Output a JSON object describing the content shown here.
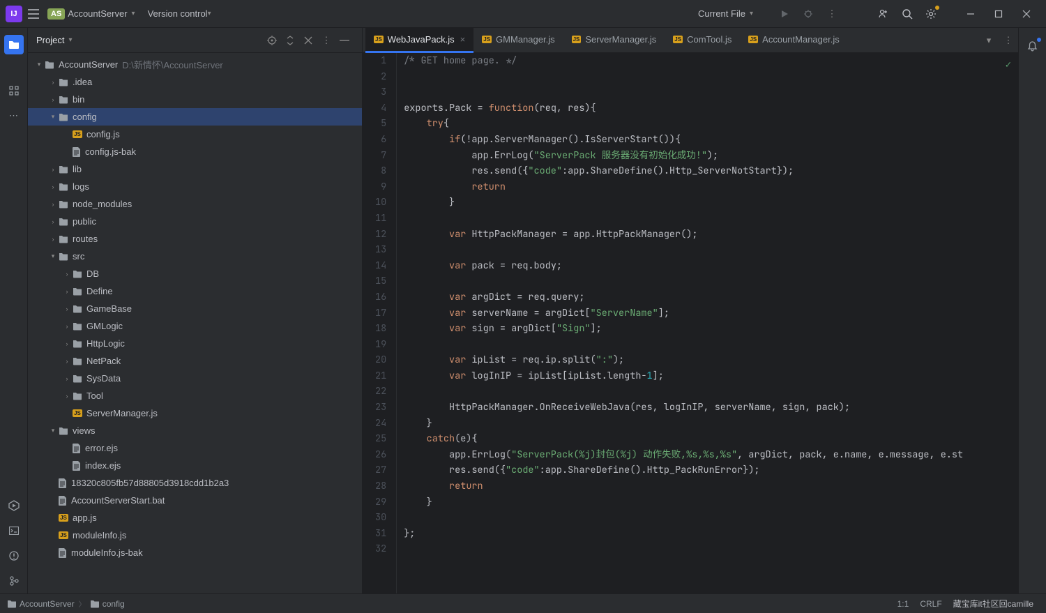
{
  "titlebar": {
    "logo": "IJ",
    "project_badge": "AS",
    "project_name": "AccountServer",
    "version_control": "Version control",
    "current_file": "Current File"
  },
  "project_panel": {
    "title": "Project"
  },
  "tree": {
    "root": "AccountServer",
    "root_hint": "D:\\新情怀\\AccountServer",
    "items": [
      {
        "t": "f",
        "l": ".idea",
        "d": 1,
        "a": ">"
      },
      {
        "t": "f",
        "l": "bin",
        "d": 1,
        "a": ">"
      },
      {
        "t": "f",
        "l": "config",
        "d": 1,
        "a": "v",
        "sel": true
      },
      {
        "t": "js",
        "l": "config.js",
        "d": 2
      },
      {
        "t": "file",
        "l": "config.js-bak",
        "d": 2
      },
      {
        "t": "f",
        "l": "lib",
        "d": 1,
        "a": ">"
      },
      {
        "t": "f",
        "l": "logs",
        "d": 1,
        "a": ">"
      },
      {
        "t": "f",
        "l": "node_modules",
        "d": 1,
        "a": ">"
      },
      {
        "t": "f",
        "l": "public",
        "d": 1,
        "a": ">"
      },
      {
        "t": "f",
        "l": "routes",
        "d": 1,
        "a": ">"
      },
      {
        "t": "f",
        "l": "src",
        "d": 1,
        "a": "v"
      },
      {
        "t": "f",
        "l": "DB",
        "d": 2,
        "a": ">"
      },
      {
        "t": "f",
        "l": "Define",
        "d": 2,
        "a": ">"
      },
      {
        "t": "f",
        "l": "GameBase",
        "d": 2,
        "a": ">"
      },
      {
        "t": "f",
        "l": "GMLogic",
        "d": 2,
        "a": ">"
      },
      {
        "t": "f",
        "l": "HttpLogic",
        "d": 2,
        "a": ">"
      },
      {
        "t": "f",
        "l": "NetPack",
        "d": 2,
        "a": ">"
      },
      {
        "t": "f",
        "l": "SysData",
        "d": 2,
        "a": ">"
      },
      {
        "t": "f",
        "l": "Tool",
        "d": 2,
        "a": ">"
      },
      {
        "t": "js",
        "l": "ServerManager.js",
        "d": 2
      },
      {
        "t": "f",
        "l": "views",
        "d": 1,
        "a": "v"
      },
      {
        "t": "file",
        "l": "error.ejs",
        "d": 2
      },
      {
        "t": "file",
        "l": "index.ejs",
        "d": 2
      },
      {
        "t": "file",
        "l": "18320c805fb57d88805d3918cdd1b2a3",
        "d": 1
      },
      {
        "t": "file",
        "l": "AccountServerStart.bat",
        "d": 1
      },
      {
        "t": "js",
        "l": "app.js",
        "d": 1
      },
      {
        "t": "js",
        "l": "moduleInfo.js",
        "d": 1
      },
      {
        "t": "file",
        "l": "moduleInfo.js-bak",
        "d": 1
      }
    ]
  },
  "tabs": [
    {
      "l": "WebJavaPack.js",
      "active": true
    },
    {
      "l": "GMManager.js"
    },
    {
      "l": "ServerManager.js"
    },
    {
      "l": "ComTool.js"
    },
    {
      "l": "AccountManager.js"
    }
  ],
  "code_lines": [
    [
      [
        "cmt",
        "/* GET home page. */"
      ]
    ],
    [],
    [],
    [
      [
        "p",
        "exports.Pack = "
      ],
      [
        "kw",
        "function"
      ],
      [
        "p",
        "(req, res){"
      ]
    ],
    [
      [
        "p",
        "    "
      ],
      [
        "kw",
        "try"
      ],
      [
        "p",
        "{"
      ]
    ],
    [
      [
        "p",
        "        "
      ],
      [
        "kw",
        "if"
      ],
      [
        "p",
        "(!app.ServerManager().IsServerStart()){"
      ]
    ],
    [
      [
        "p",
        "            app.ErrLog("
      ],
      [
        "str",
        "\"ServerPack 服务器没有初始化成功!\""
      ],
      [
        "p",
        ");"
      ]
    ],
    [
      [
        "p",
        "            res.send({"
      ],
      [
        "str",
        "\"code\""
      ],
      [
        "p",
        ":app.ShareDefine().Http_ServerNotStart});"
      ]
    ],
    [
      [
        "p",
        "            "
      ],
      [
        "kw",
        "return"
      ]
    ],
    [
      [
        "p",
        "        }"
      ]
    ],
    [],
    [
      [
        "p",
        "        "
      ],
      [
        "kw",
        "var"
      ],
      [
        "p",
        " HttpPackManager = app.HttpPackManager();"
      ]
    ],
    [],
    [
      [
        "p",
        "        "
      ],
      [
        "kw",
        "var"
      ],
      [
        "p",
        " pack = req.body;"
      ]
    ],
    [],
    [
      [
        "p",
        "        "
      ],
      [
        "kw",
        "var"
      ],
      [
        "p",
        " argDict = req.query;"
      ]
    ],
    [
      [
        "p",
        "        "
      ],
      [
        "kw",
        "var"
      ],
      [
        "p",
        " serverName = argDict["
      ],
      [
        "str",
        "\"ServerName\""
      ],
      [
        "p",
        "];"
      ]
    ],
    [
      [
        "p",
        "        "
      ],
      [
        "kw",
        "var"
      ],
      [
        "p",
        " sign = argDict["
      ],
      [
        "str",
        "\"Sign\""
      ],
      [
        "p",
        "];"
      ]
    ],
    [],
    [
      [
        "p",
        "        "
      ],
      [
        "kw",
        "var"
      ],
      [
        "p",
        " ipList = req.ip.split("
      ],
      [
        "str",
        "\":\""
      ],
      [
        "p",
        ");"
      ]
    ],
    [
      [
        "p",
        "        "
      ],
      [
        "kw",
        "var"
      ],
      [
        "p",
        " logInIP = ipList[ipList.length-"
      ],
      [
        "num",
        "1"
      ],
      [
        "p",
        "];"
      ]
    ],
    [],
    [
      [
        "p",
        "        HttpPackManager.OnReceiveWebJava(res, logInIP, serverName, sign, pack);"
      ]
    ],
    [
      [
        "p",
        "    }"
      ]
    ],
    [
      [
        "p",
        "    "
      ],
      [
        "kw",
        "catch"
      ],
      [
        "p",
        "(e){"
      ]
    ],
    [
      [
        "p",
        "        app.ErrLog("
      ],
      [
        "str",
        "\"ServerPack(%j)封包(%j) 动作失败,%s,%s,%s\""
      ],
      [
        "p",
        ", argDict, pack, e.name, e.message, e.st"
      ]
    ],
    [
      [
        "p",
        "        res.send({"
      ],
      [
        "str",
        "\"code\""
      ],
      [
        "p",
        ":app.ShareDefine().Http_PackRunError});"
      ]
    ],
    [
      [
        "p",
        "        "
      ],
      [
        "kw",
        "return"
      ]
    ],
    [
      [
        "p",
        "    }"
      ]
    ],
    [],
    [
      [
        "p",
        "};"
      ]
    ],
    []
  ],
  "status": {
    "crumb1": "AccountServer",
    "crumb2": "config",
    "pos": "1:1",
    "crlf": "CRLF",
    "watermark": "藏宝库it社区回camille"
  }
}
